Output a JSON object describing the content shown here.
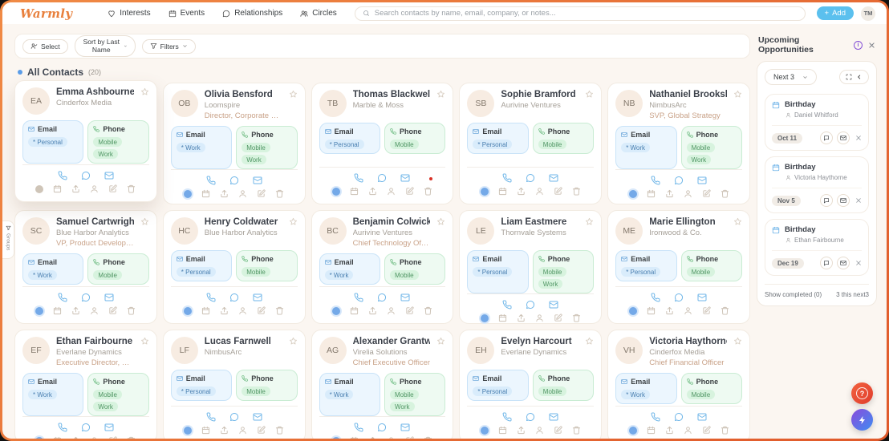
{
  "topbar": {
    "logo": "Warmly",
    "nav": [
      {
        "label": "Interests",
        "icon": "heart-icon"
      },
      {
        "label": "Events",
        "icon": "calendar-icon"
      },
      {
        "label": "Relationships",
        "icon": "chat-icon"
      },
      {
        "label": "Circles",
        "icon": "people-icon"
      }
    ],
    "search_placeholder": "Search contacts by name, email, company, or notes...",
    "add_label": "Add",
    "avatar_initials": "TM"
  },
  "toolbar": {
    "select_label": "Select",
    "sort_label": "Sort by Last Name",
    "filters_label": "Filters"
  },
  "groups_tab": {
    "label": "Groups"
  },
  "contacts_section": {
    "title": "All Contacts",
    "count": "(20)"
  },
  "contact_labels": {
    "email": "Email",
    "phone": "Phone"
  },
  "contacts": [
    {
      "initials": "EA",
      "name": "Emma Ashbourne",
      "company": "Cinderfox Media",
      "title": "",
      "email_badge": "* Personal",
      "phone_badges": [
        "Mobile",
        "Work"
      ],
      "dot": "gray",
      "elevated": true,
      "alert": false
    },
    {
      "initials": "OB",
      "name": "Olivia Bensford",
      "company": "Loomspire",
      "title": "Director, Corporate Communic...",
      "email_badge": "* Work",
      "phone_badges": [
        "Mobile",
        "Work"
      ],
      "dot": "blue",
      "elevated": false,
      "alert": false
    },
    {
      "initials": "TB",
      "name": "Thomas Blackwell",
      "company": "Marble & Moss",
      "title": "",
      "email_badge": "* Personal",
      "phone_badges": [
        "Mobile"
      ],
      "dot": "blue",
      "elevated": false,
      "alert": true
    },
    {
      "initials": "SB",
      "name": "Sophie Bramford",
      "company": "Aurivine Ventures",
      "title": "",
      "email_badge": "* Personal",
      "phone_badges": [
        "Mobile"
      ],
      "dot": "blue",
      "elevated": false,
      "alert": false
    },
    {
      "initials": "NB",
      "name": "Nathaniel Brookshire",
      "company": "NimbusArc",
      "title": "SVP, Global Strategy",
      "email_badge": "* Work",
      "phone_badges": [
        "Mobile",
        "Work"
      ],
      "dot": "blue",
      "elevated": false,
      "alert": false
    },
    {
      "initials": "SC",
      "name": "Samuel Cartwright",
      "company": "Blue Harbor Analytics",
      "title": "VP, Product Development",
      "email_badge": "* Work",
      "phone_badges": [
        "Mobile"
      ],
      "dot": "blue",
      "elevated": false,
      "alert": false
    },
    {
      "initials": "HC",
      "name": "Henry Coldwater",
      "company": "Blue Harbor Analytics",
      "title": "",
      "email_badge": "* Personal",
      "phone_badges": [
        "Mobile"
      ],
      "dot": "blue",
      "elevated": false,
      "alert": false
    },
    {
      "initials": "BC",
      "name": "Benjamin Colwick",
      "company": "Aurivine Ventures",
      "title": "Chief Technology Officer",
      "email_badge": "* Work",
      "phone_badges": [
        "Mobile"
      ],
      "dot": "blue",
      "elevated": false,
      "alert": false
    },
    {
      "initials": "LE",
      "name": "Liam Eastmere",
      "company": "Thornvale Systems",
      "title": "",
      "email_badge": "* Personal",
      "phone_badges": [
        "Mobile",
        "Work"
      ],
      "dot": "blue",
      "elevated": false,
      "alert": false
    },
    {
      "initials": "ME",
      "name": "Marie Ellington",
      "company": "Ironwood & Co.",
      "title": "",
      "email_badge": "* Personal",
      "phone_badges": [
        "Mobile"
      ],
      "dot": "blue",
      "elevated": false,
      "alert": false
    },
    {
      "initials": "EF",
      "name": "Ethan Fairbourne",
      "company": "Everlane Dynamics",
      "title": "Executive Director, Business O...",
      "email_badge": "* Work",
      "phone_badges": [
        "Mobile",
        "Work"
      ],
      "dot": "blue",
      "elevated": false,
      "alert": false
    },
    {
      "initials": "LF",
      "name": "Lucas Farnwell",
      "company": "NimbusArc",
      "title": "",
      "email_badge": "* Personal",
      "phone_badges": [
        "Mobile"
      ],
      "dot": "blue",
      "elevated": false,
      "alert": false
    },
    {
      "initials": "AG",
      "name": "Alexander Grantwell",
      "company": "Virelia Solutions",
      "title": "Chief Executive Officer",
      "email_badge": "* Work",
      "phone_badges": [
        "Mobile",
        "Work"
      ],
      "dot": "blue",
      "elevated": false,
      "alert": false
    },
    {
      "initials": "EH",
      "name": "Evelyn Harcourt",
      "company": "Everlane Dynamics",
      "title": "",
      "email_badge": "* Personal",
      "phone_badges": [
        "Mobile"
      ],
      "dot": "blue",
      "elevated": false,
      "alert": false
    },
    {
      "initials": "VH",
      "name": "Victoria Haythorne",
      "company": "Cinderfox Media",
      "title": "Chief Financial Officer",
      "email_badge": "* Work",
      "phone_badges": [
        "Mobile"
      ],
      "dot": "blue",
      "elevated": false,
      "alert": false
    }
  ],
  "opportunities_panel": {
    "title": "Upcoming Opportunities",
    "filter_label": "Next 3",
    "items": [
      {
        "type": "Birthday",
        "person": "Daniel Whitford",
        "date": "Oct 11"
      },
      {
        "type": "Birthday",
        "person": "Victoria Haythorne",
        "date": "Nov 5"
      },
      {
        "type": "Birthday",
        "person": "Ethan Fairbourne",
        "date": "Dec 19"
      }
    ],
    "show_completed": "Show completed (0)",
    "next_summary": "3 this next3"
  },
  "colors": {
    "brand-orange": "#e8803d",
    "accent-blue": "#5bc0ee",
    "icon-blue": "#6fb6e8",
    "title-tan": "#c9a288",
    "red-dot": "#d93025",
    "purple": "#8653d7"
  }
}
